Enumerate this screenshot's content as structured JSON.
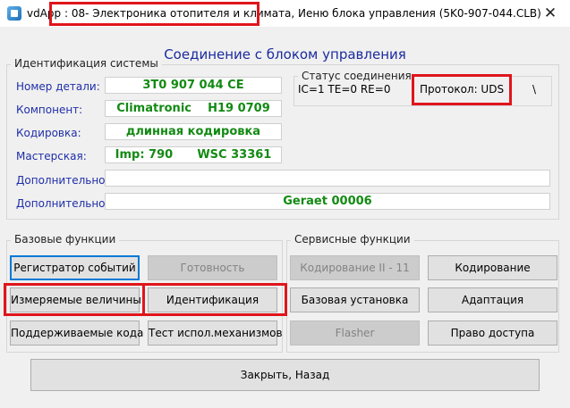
{
  "window": {
    "title": "vdApp : 08- Электроника отопителя и климата,   Иеню блока управления (5K0-907-044.CLB)",
    "close_glyph": "✕",
    "icon": "app-icon"
  },
  "header": {
    "title": "Соединение с блоком управления"
  },
  "identification": {
    "group_label": "Идентификация системы",
    "fields": [
      {
        "label": "Номер детали:",
        "value": "3T0 907 044 CE"
      },
      {
        "label": "Компонент:",
        "value": "Climatronic    H19 0709"
      },
      {
        "label": "Кодировка:",
        "value": "длинная кодировка"
      },
      {
        "label": "Мастерская:",
        "value": "Imp: 790      WSC 33361"
      },
      {
        "label": "Дополнительно:",
        "value": ""
      },
      {
        "label": "Дополнительно:",
        "value": "Geraet 00006"
      }
    ]
  },
  "connection_status": {
    "group_label": "Статус соединения",
    "ic": "IC=1  TE=0   RE=0",
    "protocol": "Протокол: UDS",
    "spinner": "\\"
  },
  "basic_functions": {
    "group_label": "Базовые функции",
    "buttons": [
      {
        "label": "Регистратор событий",
        "enabled": true,
        "focused": true
      },
      {
        "label": "Готовность",
        "enabled": false
      },
      {
        "label": "Измеряемые величины",
        "enabled": true
      },
      {
        "label": "Идентификация",
        "enabled": true
      },
      {
        "label": "Поддерживаемые кода",
        "enabled": true
      },
      {
        "label": "Тест испол.механизмов",
        "enabled": true
      }
    ]
  },
  "service_functions": {
    "group_label": "Сервисные функции",
    "buttons": [
      {
        "label": "Кодирование II - 11",
        "enabled": false
      },
      {
        "label": "Кодирование",
        "enabled": true
      },
      {
        "label": "Базовая установка",
        "enabled": true
      },
      {
        "label": "Адаптация",
        "enabled": true
      },
      {
        "label": "Flasher",
        "enabled": false
      },
      {
        "label": "Право доступа",
        "enabled": true
      }
    ]
  },
  "footer": {
    "close_label": "Закрыть, Назад"
  },
  "colors": {
    "accent": "#0078d7",
    "highlight": "#e0151b",
    "label_blue": "#1f2fa8",
    "value_green": "#138a13"
  }
}
